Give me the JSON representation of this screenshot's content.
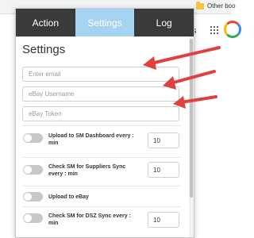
{
  "browser": {
    "bookmark_label": "Other boo",
    "partial_text": "s"
  },
  "tabs": [
    {
      "label": "Action",
      "active": false
    },
    {
      "label": "Settings",
      "active": true
    },
    {
      "label": "Log",
      "active": false
    }
  ],
  "settings": {
    "title": "Settings",
    "email_placeholder": "Enter email",
    "username_placeholder": "eBay Username",
    "token_placeholder": "eBay Token",
    "rows": [
      {
        "label": "Upload to SM Dashboard every : min",
        "value": "10",
        "toggle_on": false
      },
      {
        "label": "Check SM for Suppliers Sync every : min",
        "value": "10",
        "toggle_on": false
      },
      {
        "label": "Upload to eBay",
        "value": "",
        "toggle_on": false
      },
      {
        "label": "Check SM for DSZ Sync every : min",
        "value": "10",
        "toggle_on": false
      }
    ]
  },
  "colors": {
    "tab_bar": "#3a3a3a",
    "active_tab": "#a5d4f2",
    "arrow": "#e04040"
  }
}
